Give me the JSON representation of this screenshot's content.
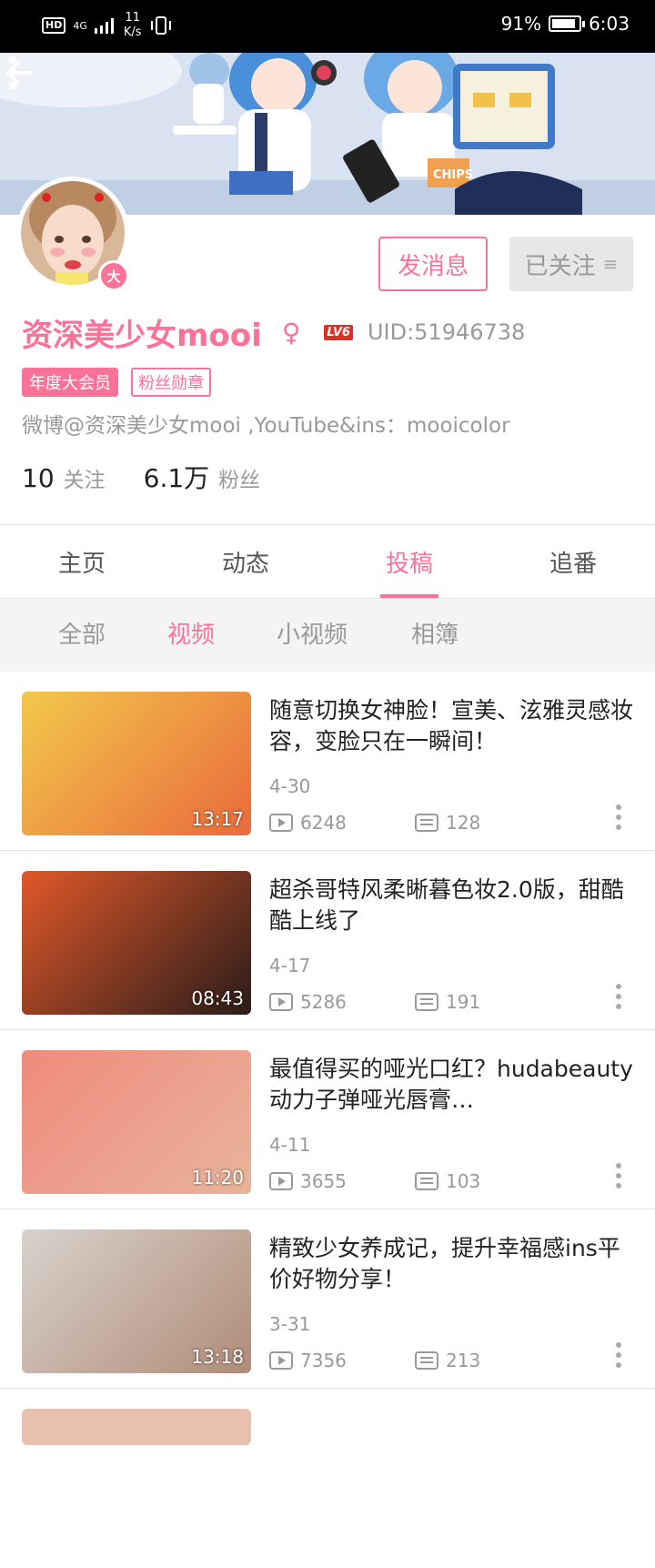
{
  "status_bar": {
    "left_badge": "HD",
    "network": "4G",
    "speed_value": "11",
    "speed_unit": "K/s",
    "battery_percent": "91%",
    "battery_level": 0.91,
    "time": "6:03"
  },
  "profile": {
    "vip_badge": "大",
    "send_message_label": "发消息",
    "followed_label": "已关注",
    "username": "资深美少女mooi",
    "gender_symbol": "♀",
    "level_badge": "LV6",
    "uid": "UID:51946738",
    "tags": [
      "年度大会员",
      "粉丝勋章"
    ],
    "bio": "微博@资深美少女mooi ,YouTube&ins：mooicolor",
    "following_count": "10",
    "following_label": "关注",
    "followers_count": "6.1万",
    "followers_label": "粉丝"
  },
  "tabs": [
    "主页",
    "动态",
    "投稿",
    "追番"
  ],
  "active_tab": "投稿",
  "subtabs": [
    "全部",
    "视频",
    "小视频",
    "相簿"
  ],
  "active_subtab": "视频",
  "videos": [
    {
      "title": "随意切换女神脸！宣美、泫雅灵感妆容，变脸只在一瞬间！",
      "duration": "13:17",
      "date": "4-30",
      "views": "6248",
      "comments": "128",
      "thumb_colors": [
        "#f2c84b",
        "#e96a3c"
      ]
    },
    {
      "title": "超杀哥特风柔晰暮色妆2.0版，甜酷酷上线了",
      "duration": "08:43",
      "date": "4-17",
      "views": "5286",
      "comments": "191",
      "thumb_colors": [
        "#e0582a",
        "#2a1c1a"
      ]
    },
    {
      "title": "最值得买的哑光口红？hudabeauty动力子弹哑光唇膏…",
      "duration": "11:20",
      "date": "4-11",
      "views": "3655",
      "comments": "103",
      "thumb_colors": [
        "#f08a7e",
        "#e8b49a"
      ]
    },
    {
      "title": "精致少女养成记，提升幸福感ins平价好物分享！",
      "duration": "13:18",
      "date": "3-31",
      "views": "7356",
      "comments": "213",
      "thumb_colors": [
        "#d8d2cc",
        "#b08c78"
      ]
    }
  ]
}
